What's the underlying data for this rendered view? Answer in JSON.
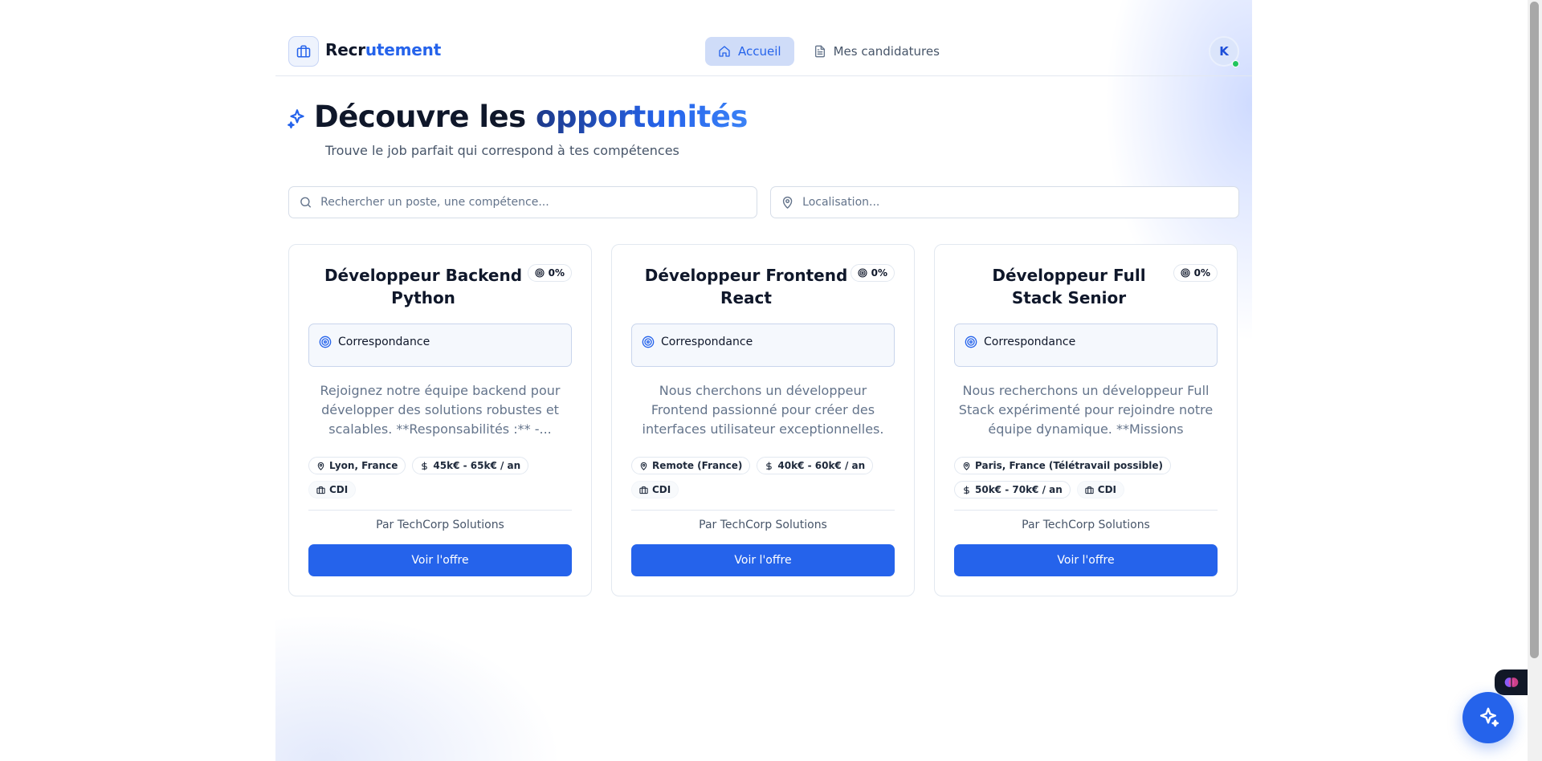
{
  "header": {
    "brand_prefix": "Recr",
    "brand_accent": "utement",
    "nav": [
      {
        "label": "Accueil",
        "active": true
      },
      {
        "label": "Mes candidatures",
        "active": false
      }
    ],
    "avatar_initial": "K"
  },
  "hero": {
    "title_main": "Découvre les ",
    "title_accent": "opportunités",
    "subtitle": "Trouve le job parfait qui correspond à tes compétences"
  },
  "search": {
    "query_placeholder": "Rechercher un poste, une compétence...",
    "location_placeholder": "Localisation..."
  },
  "jobs": [
    {
      "title": "Développeur Backend Python",
      "match_percent": "0%",
      "match_label": "Correspondance",
      "description": "Rejoignez notre équipe backend pour développer des solutions robustes et scalables. **Responsabilités :** -...",
      "location": "Lyon, France",
      "salary": "45k€ - 65k€ / an",
      "contract": "CDI",
      "company": "Par TechCorp Solutions",
      "cta": "Voir l'offre"
    },
    {
      "title": "Développeur Frontend React",
      "match_percent": "0%",
      "match_label": "Correspondance",
      "description": "Nous cherchons un développeur Frontend passionné pour créer des interfaces utilisateur exceptionnelles. **Votre missio...",
      "location": "Remote (France)",
      "salary": "40k€ - 60k€ / an",
      "contract": "CDI",
      "company": "Par TechCorp Solutions",
      "cta": "Voir l'offre"
    },
    {
      "title": "Développeur Full Stack Senior",
      "match_percent": "0%",
      "match_label": "Correspondance",
      "description": "Nous recherchons un développeur Full Stack expérimenté pour rejoindre notre équipe dynamique. **Missions principale...",
      "location": "Paris, France (Télétravail possible)",
      "salary": "50k€ - 70k€ / an",
      "contract": "CDI",
      "company": "Par TechCorp Solutions",
      "cta": "Voir l'offre"
    }
  ],
  "colors": {
    "primary": "#2563eb",
    "nav_active_bg": "#cfdcf8",
    "online": "#22c55e"
  }
}
